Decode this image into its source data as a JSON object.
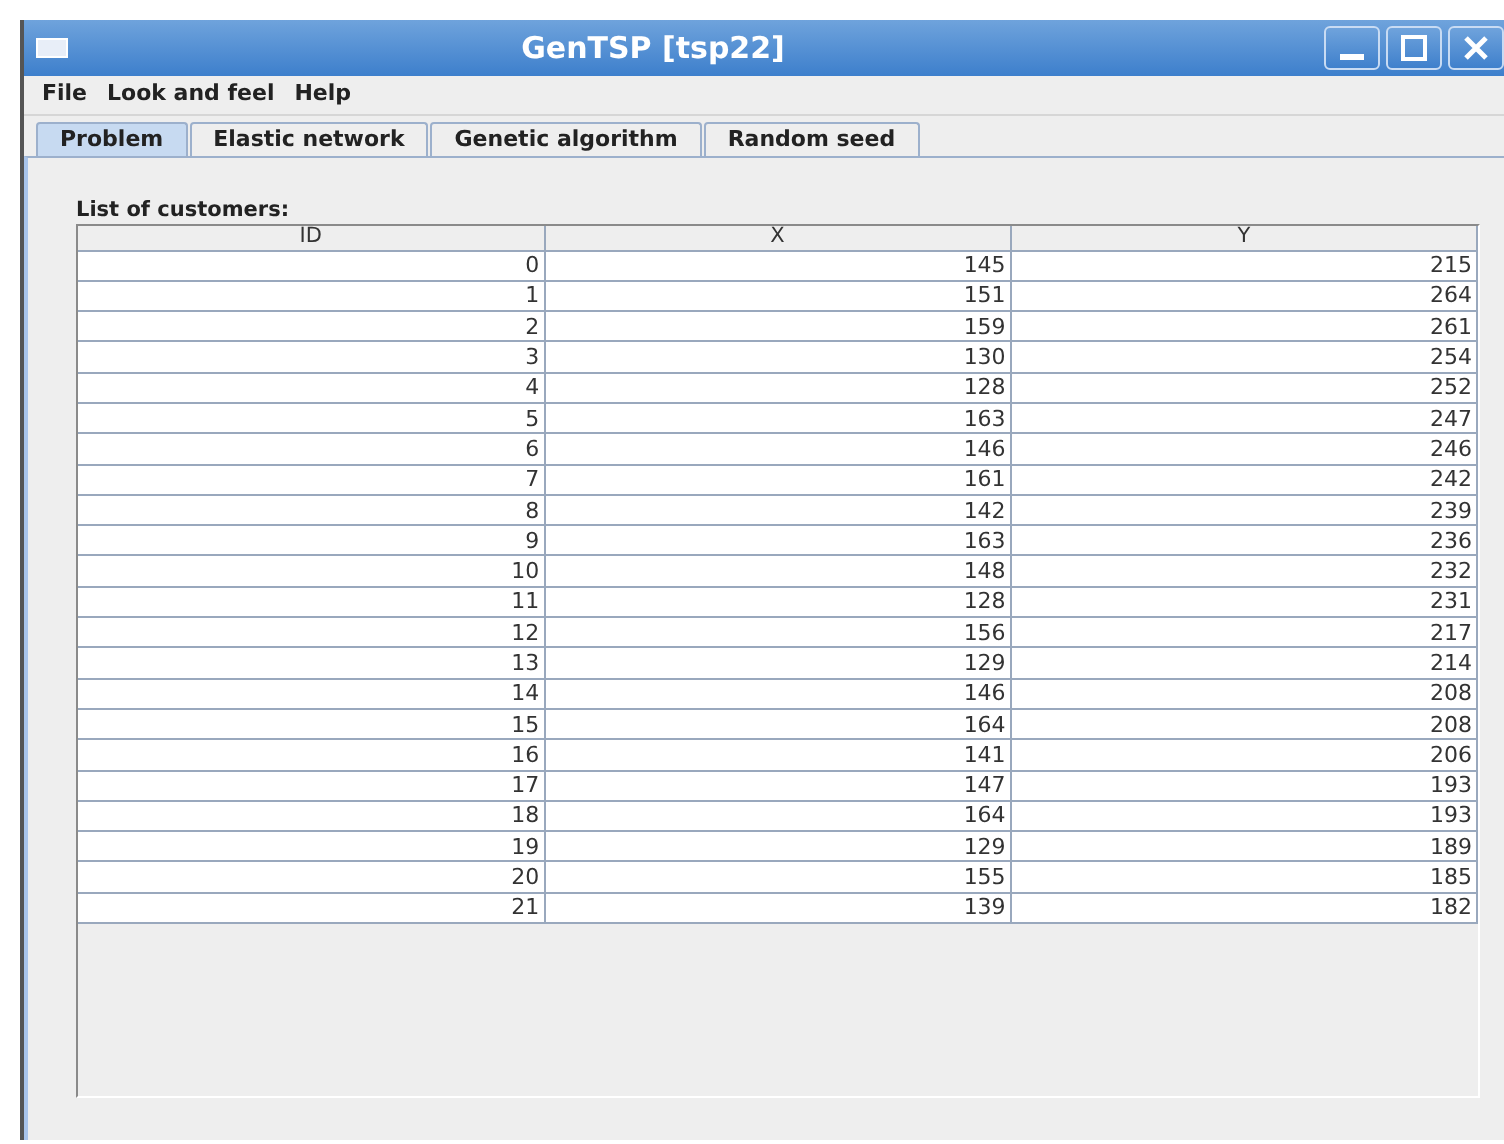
{
  "window": {
    "title": "GenTSP [tsp22]"
  },
  "menu": [
    "File",
    "Look and feel",
    "Help"
  ],
  "tabs": [
    {
      "label": "Problem",
      "selected": true
    },
    {
      "label": "Elastic network",
      "selected": false
    },
    {
      "label": "Genetic algorithm",
      "selected": false
    },
    {
      "label": "Random seed",
      "selected": false
    }
  ],
  "table": {
    "label": "List of customers:",
    "columns": [
      "ID",
      "X",
      "Y"
    ],
    "rows": [
      [
        "0",
        "145",
        "215"
      ],
      [
        "1",
        "151",
        "264"
      ],
      [
        "2",
        "159",
        "261"
      ],
      [
        "3",
        "130",
        "254"
      ],
      [
        "4",
        "128",
        "252"
      ],
      [
        "5",
        "163",
        "247"
      ],
      [
        "6",
        "146",
        "246"
      ],
      [
        "7",
        "161",
        "242"
      ],
      [
        "8",
        "142",
        "239"
      ],
      [
        "9",
        "163",
        "236"
      ],
      [
        "10",
        "148",
        "232"
      ],
      [
        "11",
        "128",
        "231"
      ],
      [
        "12",
        "156",
        "217"
      ],
      [
        "13",
        "129",
        "214"
      ],
      [
        "14",
        "146",
        "208"
      ],
      [
        "15",
        "164",
        "208"
      ],
      [
        "16",
        "141",
        "206"
      ],
      [
        "17",
        "147",
        "193"
      ],
      [
        "18",
        "164",
        "193"
      ],
      [
        "19",
        "129",
        "189"
      ],
      [
        "20",
        "155",
        "185"
      ],
      [
        "21",
        "139",
        "182"
      ]
    ]
  }
}
